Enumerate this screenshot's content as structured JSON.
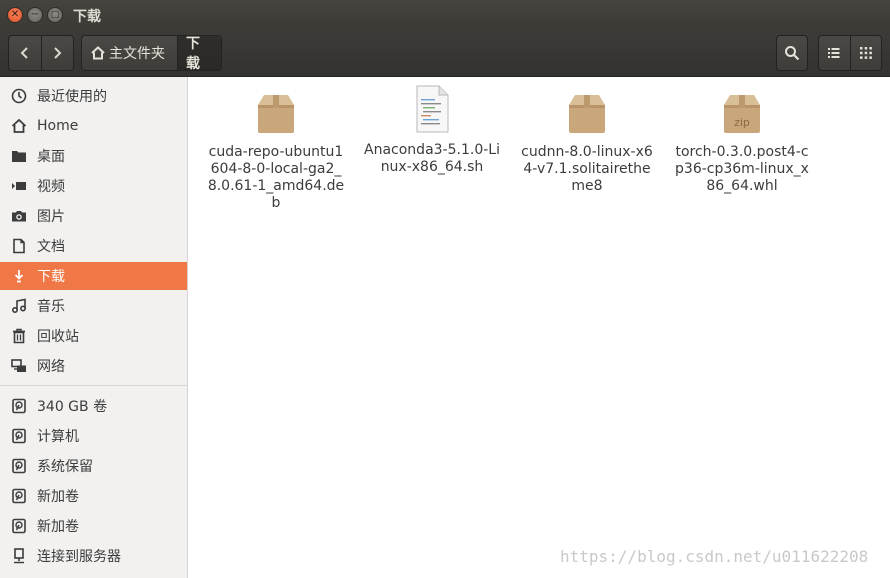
{
  "window": {
    "title": "下载"
  },
  "toolbar": {
    "back_icon": "chevron-left-icon",
    "forward_icon": "chevron-right-icon",
    "path": [
      {
        "label": "主文件夹",
        "icon": "home-icon"
      },
      {
        "label": "下载"
      }
    ],
    "search_icon": "search-icon",
    "list_view_icon": "list-view-icon",
    "grid_view_icon": "grid-view-icon"
  },
  "sidebar": {
    "places": [
      {
        "label": "最近使用的",
        "icon": "clock-icon"
      },
      {
        "label": "Home",
        "icon": "home-icon"
      },
      {
        "label": "桌面",
        "icon": "folder-icon"
      },
      {
        "label": "视频",
        "icon": "video-icon"
      },
      {
        "label": "图片",
        "icon": "camera-icon"
      },
      {
        "label": "文档",
        "icon": "document-icon"
      },
      {
        "label": "下载",
        "icon": "download-icon",
        "active": true
      },
      {
        "label": "音乐",
        "icon": "music-icon"
      },
      {
        "label": "回收站",
        "icon": "trash-icon"
      },
      {
        "label": "网络",
        "icon": "network-icon"
      }
    ],
    "devices": [
      {
        "label": "340 GB 卷",
        "icon": "drive-icon"
      },
      {
        "label": "计算机",
        "icon": "drive-icon"
      },
      {
        "label": "系统保留",
        "icon": "drive-icon"
      },
      {
        "label": "新加卷",
        "icon": "drive-icon"
      },
      {
        "label": "新加卷",
        "icon": "drive-icon"
      },
      {
        "label": "连接到服务器",
        "icon": "server-icon"
      }
    ]
  },
  "files": [
    {
      "name": "cuda-repo-ubuntu1604-8-0-local-ga2_8.0.61-1_amd64.deb",
      "icon": "package-icon"
    },
    {
      "name": "Anaconda3-5.1.0-Linux-x86_64.sh",
      "icon": "script-file-icon"
    },
    {
      "name": "cudnn-8.0-linux-x64-v7.1.solitairetheme8",
      "icon": "package-icon"
    },
    {
      "name": "torch-0.3.0.post4-cp36-cp36m-linux_x86_64.whl",
      "icon": "zip-package-icon",
      "badge": "zip"
    }
  ],
  "watermark": "https://blog.csdn.net/u011622208",
  "colors": {
    "accent": "#f07746",
    "titlebar": "#3c3b37",
    "sidebar_bg": "#f2f1f0"
  }
}
